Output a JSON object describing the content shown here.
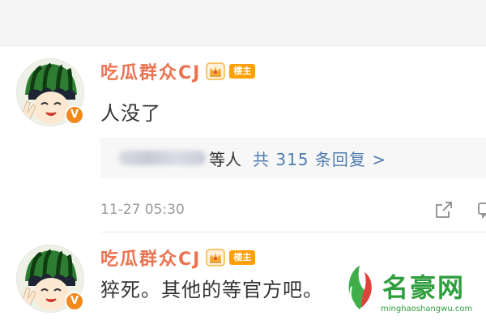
{
  "comments": [
    {
      "username": "吃瓜群众CJ",
      "op_badge": "楼主",
      "verified_badge": "V",
      "text": "人没了",
      "reply_summary": {
        "people_suffix": "等人",
        "link": "共 315 条回复 >"
      },
      "timestamp": "11-27 05:30",
      "icons": [
        "avatar-image",
        "verified-badge",
        "crown-icon",
        "share-icon",
        "comment-icon"
      ]
    },
    {
      "username": "吃瓜群众CJ",
      "op_badge": "楼主",
      "verified_badge": "V",
      "text": "猝死。其他的等官方吧。",
      "icons": [
        "avatar-image",
        "verified-badge",
        "crown-icon"
      ]
    }
  ],
  "watermark": {
    "title": "名豪网",
    "url": "minghaoshangwu.com"
  },
  "colors": {
    "username": "#eb7350",
    "link": "#507daf",
    "op_badge": "#ffa00a",
    "verified_badge": "#f08a1c",
    "watermark": "#2f9e3e"
  }
}
